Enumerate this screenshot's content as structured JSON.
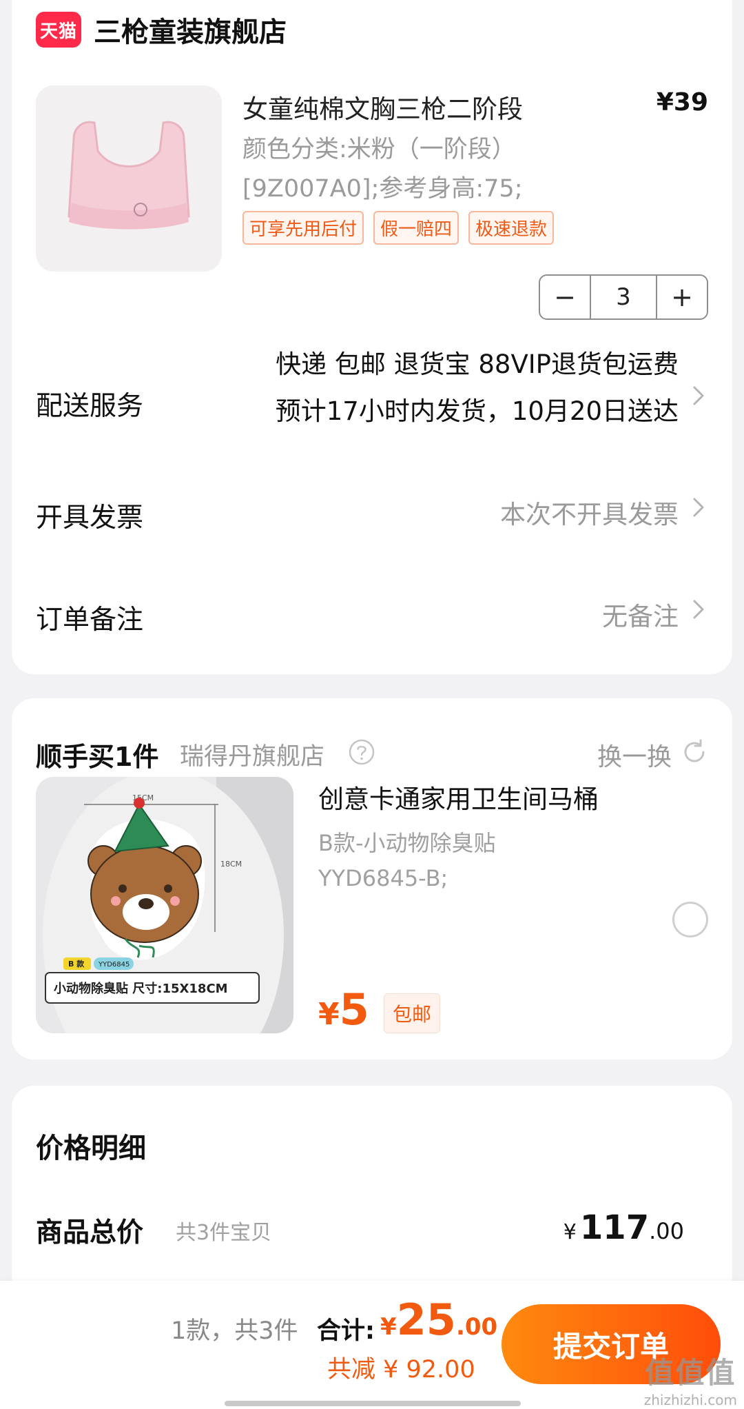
{
  "store": {
    "logo_text": "天猫",
    "name": "三枪童装旗舰店",
    "product": {
      "title": "女童纯棉文胸三枪二阶段",
      "price": "¥39",
      "spec_color": "颜色分类:米粉（一阶段）",
      "spec_size": "[9Z007A0];参考身高:75;",
      "tags": [
        "可享先用后付",
        "假一赔四",
        "极速退款"
      ],
      "quantity": "3",
      "minus_label": "−",
      "plus_label": "+"
    },
    "delivery": {
      "label": "配送服务",
      "line1": "快递 包邮 退货宝 88VIP退货包运费",
      "line2": "预计17小时内发货，10月20日送达"
    },
    "invoice": {
      "label": "开具发票",
      "value": "本次不开具发票"
    },
    "note": {
      "label": "订单备注",
      "value": "无备注"
    }
  },
  "addon": {
    "title": "顺手买1件",
    "store": "瑞得丹旗舰店",
    "swap_label": "换一换",
    "item": {
      "name": "创意卡通家用卫生间马桶",
      "spec1": "B款-小动物除臭贴",
      "spec2": "YYD6845-B;",
      "price_currency": "¥",
      "price": "5",
      "shipping": "包邮",
      "image_text": {
        "dim_w": "15CM",
        "dim_h": "18CM",
        "badge_b": "B 款",
        "badge_code": "YYD6845",
        "caption": "小动物除臭贴   尺寸:15X18CM"
      }
    }
  },
  "price_detail": {
    "title": "价格明细",
    "total_label": "商品总价",
    "total_note": "共3件宝贝",
    "total_currency": "¥",
    "total_int": "117",
    "total_dec": ".00"
  },
  "bottom_bar": {
    "count": "1款，共3件",
    "sum_label": "合计:",
    "sum_currency": "¥",
    "sum_int": "25",
    "sum_dec": ".00",
    "discount": "共减 ¥ 92.00",
    "submit_label": "提交订单"
  },
  "watermark": {
    "main": "值值值",
    "sub": "zhizhizhi.com"
  },
  "colors": {
    "accent": "#f25a0f",
    "tmall": "#ff2a4a",
    "muted": "#9a9a9a"
  }
}
